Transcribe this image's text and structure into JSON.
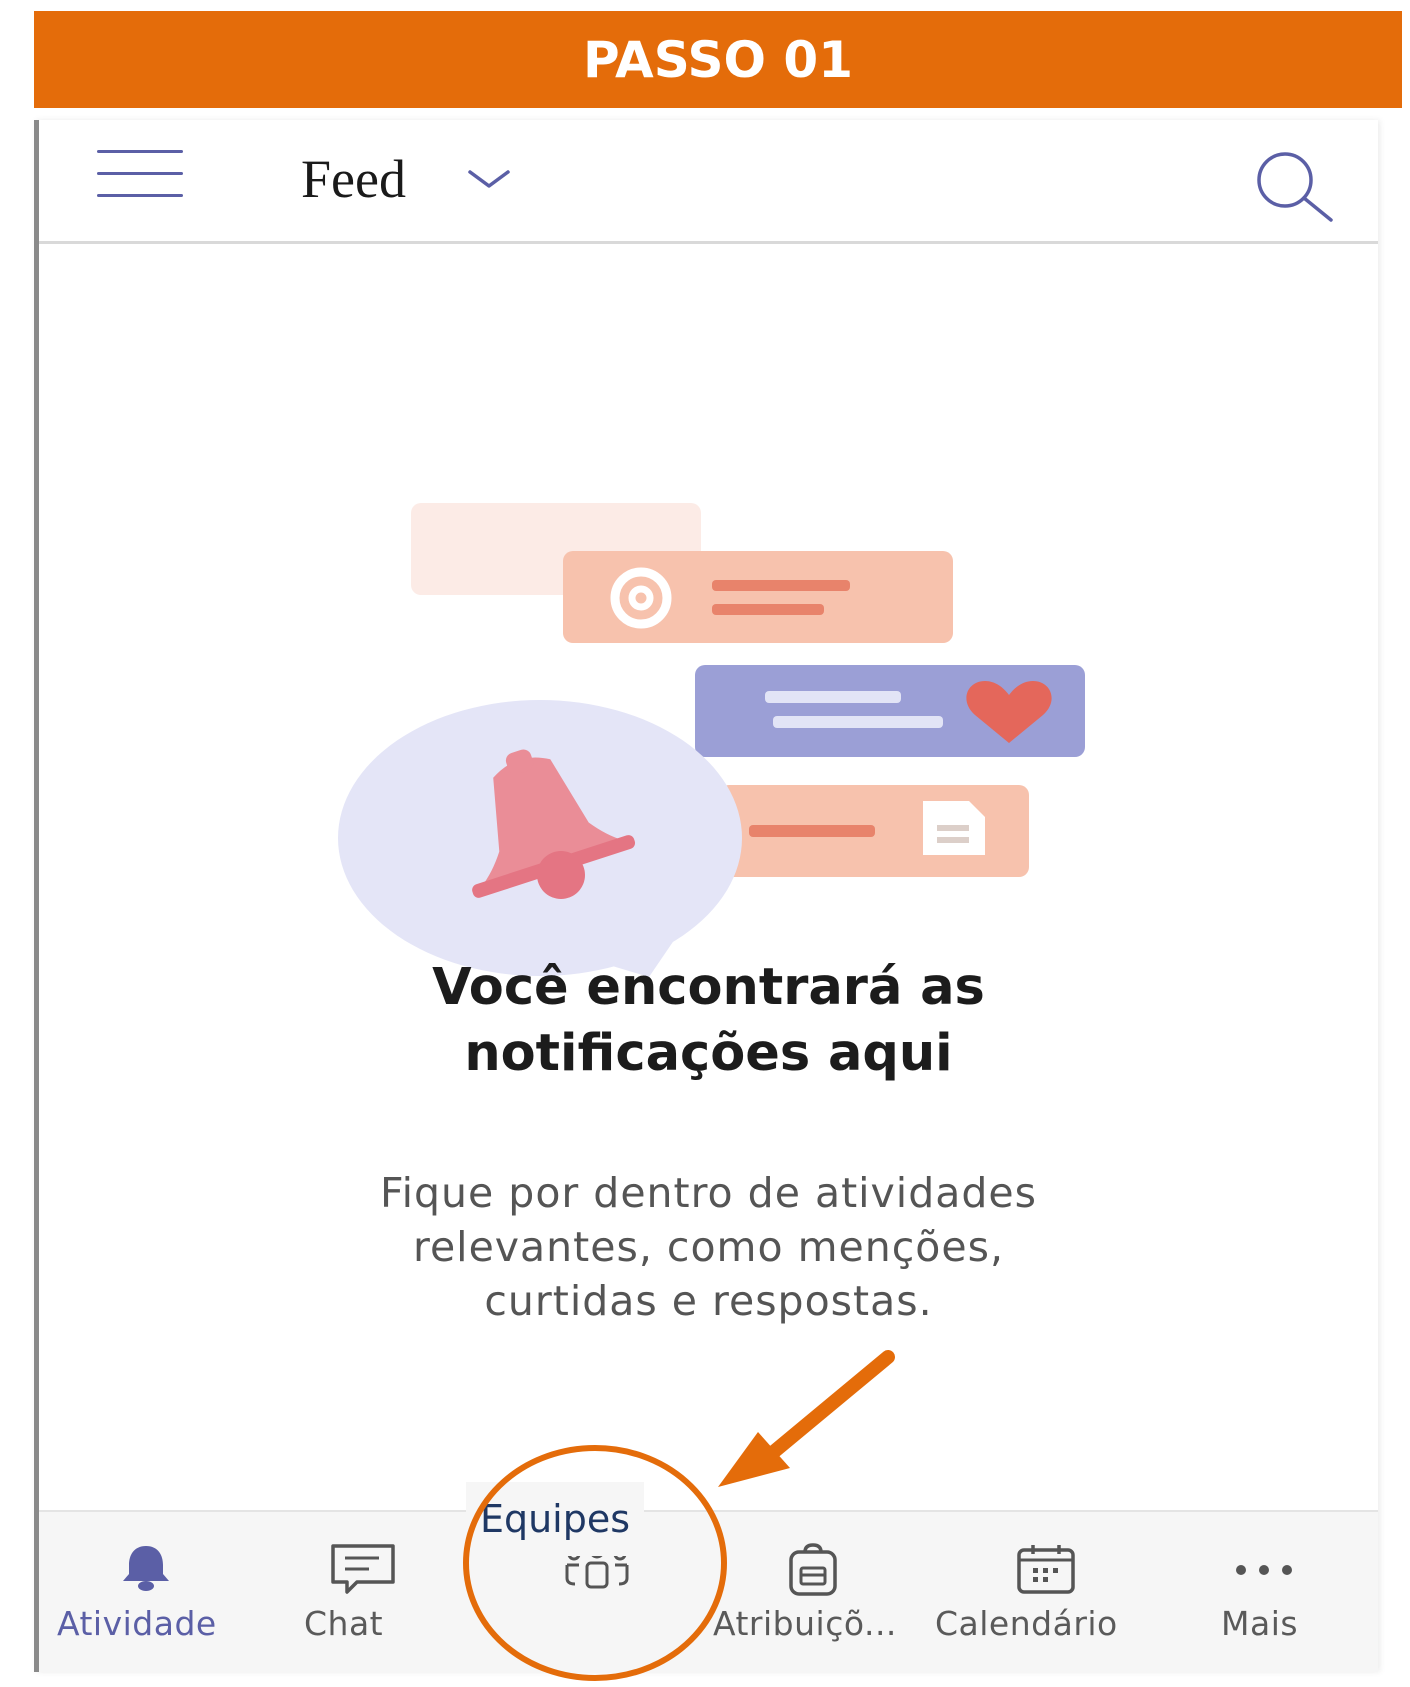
{
  "banner": {
    "title": "PASSO 01"
  },
  "topbar": {
    "title": "Feed"
  },
  "empty_state": {
    "headline": [
      "Você encontrará as",
      "notificações aqui"
    ],
    "description": [
      "Fique por dentro de atividades",
      "relevantes, como menções,",
      "curtidas e respostas."
    ]
  },
  "bottom_nav": {
    "items": [
      {
        "label": "Atividade",
        "icon": "bell-icon",
        "active": true
      },
      {
        "label": "Chat",
        "icon": "chat-icon",
        "active": false
      },
      {
        "label": "Equipes",
        "icon": "teams-icon",
        "active": false
      },
      {
        "label": "Atribuiçõ...",
        "icon": "assignments-icon",
        "active": false
      },
      {
        "label": "Calendário",
        "icon": "calendar-icon",
        "active": false
      },
      {
        "label": "Mais",
        "icon": "more-icon",
        "active": false
      }
    ]
  },
  "annotation": {
    "highlighted_tab": "Equipes",
    "color": "#e46c0a"
  },
  "colors": {
    "accent": "#5b5fa6",
    "banner": "#e46c0a"
  }
}
